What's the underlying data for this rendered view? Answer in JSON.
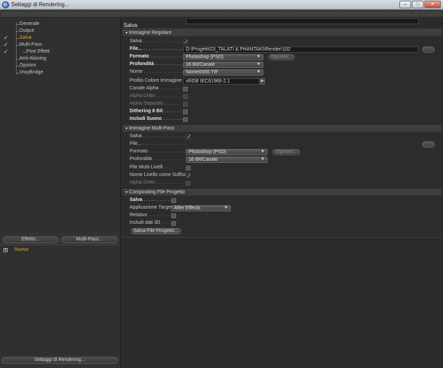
{
  "window": {
    "title": "Settaggi di Rendering...",
    "btn_min": "–",
    "btn_max": "□",
    "btn_close": "✕"
  },
  "tree": {
    "items": [
      {
        "label": "Generale",
        "checked": false
      },
      {
        "label": "Output",
        "checked": false
      },
      {
        "label": "Salva",
        "checked": true
      },
      {
        "label": "Multi-Pass",
        "checked": true
      },
      {
        "label": "Post Effetti",
        "checked": true
      },
      {
        "label": "Anti-Aliasing",
        "checked": false
      },
      {
        "label": "Opzioni",
        "checked": false
      },
      {
        "label": "VrayBridge",
        "checked": false
      }
    ],
    "check_glyph": "✓"
  },
  "left_buttons": {
    "effect": "Effetto...",
    "multipass": "Multi-Pass..."
  },
  "presets": {
    "item": "Nuovo",
    "mark": "x"
  },
  "bottom_button": "Settaggi di Rendering...",
  "panel": {
    "title": "Salva"
  },
  "regular": {
    "header": "Immagine Regolare",
    "save_label": "Salva",
    "file_label": "File...",
    "file_path": "D:\\Progetti\\23_TALATI & PHANTAKI\\Render\\102",
    "format_label": "Formato",
    "format_value": "Photoshop (PSD)",
    "options_btn": "Opzioni...",
    "depth_label": "Profondità",
    "depth_value": "16 Bit/Canale",
    "name_label": "Nome",
    "name_value": "Nome0000.TIF",
    "profile_label": "Profilo Colore Immagine",
    "profile_value": "sRGB IEC61966-2.1",
    "alpha_label": "Canale Alpha",
    "alpha_straight_label": "Alpha Dritto",
    "alpha_separate_label": "Alpha Separato",
    "dither_label": "Dithering 8 Bit",
    "sound_label": "Includi Suono"
  },
  "multipass": {
    "header": "Immagine Multi-Pass",
    "save_label": "Salva",
    "file_label": "File...",
    "format_label": "Formato",
    "format_value": "Photoshop (PSD)",
    "options_btn": "Opzioni...",
    "depth_label": "Profondità",
    "depth_value": "16 Bit/Canale",
    "multilayer_label": "File Multi-Livelli",
    "suffix_label": "Nome Livello come Suffisso",
    "alpha_straight_label": "Alpha Dritto"
  },
  "compositing": {
    "header": "Compositing File Progetto",
    "save_label": "Salva",
    "target_label": "Applicazione Target",
    "target_value": "After Effects",
    "relative_label": "Relativo",
    "include3d_label": "Includi dati 3D",
    "save_project_btn": "Salva File Progetto..."
  },
  "glyphs": {
    "check": "✓",
    "down": "▼",
    "right": "▶",
    "section": "▾"
  }
}
